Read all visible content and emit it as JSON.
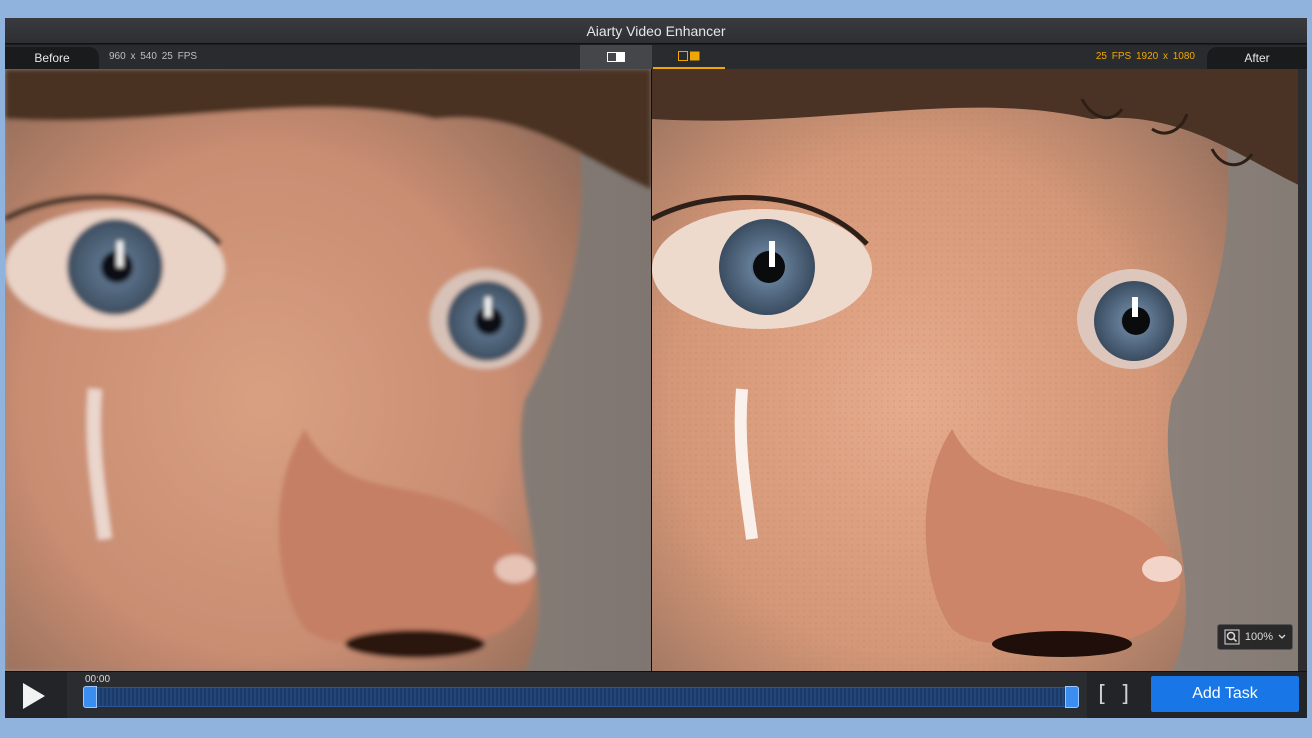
{
  "window": {
    "title": "Aiarty Video Enhancer"
  },
  "infobar": {
    "before_label": "Before",
    "after_label": "After",
    "before_meta": "960 x 540  25 FPS",
    "after_meta": "25 FPS  1920 x 1080"
  },
  "viewer": {
    "zoom_label": "100%",
    "accent_color": "#f0a800"
  },
  "playback": {
    "time": "00:00",
    "add_task_label": "Add Task",
    "accent_color": "#1976e6"
  },
  "icons": {
    "play": "play-icon",
    "single_view": "single-view-icon",
    "split_view": "split-view-icon",
    "zoom": "zoom-icon",
    "chevron": "chevron-down-icon"
  }
}
